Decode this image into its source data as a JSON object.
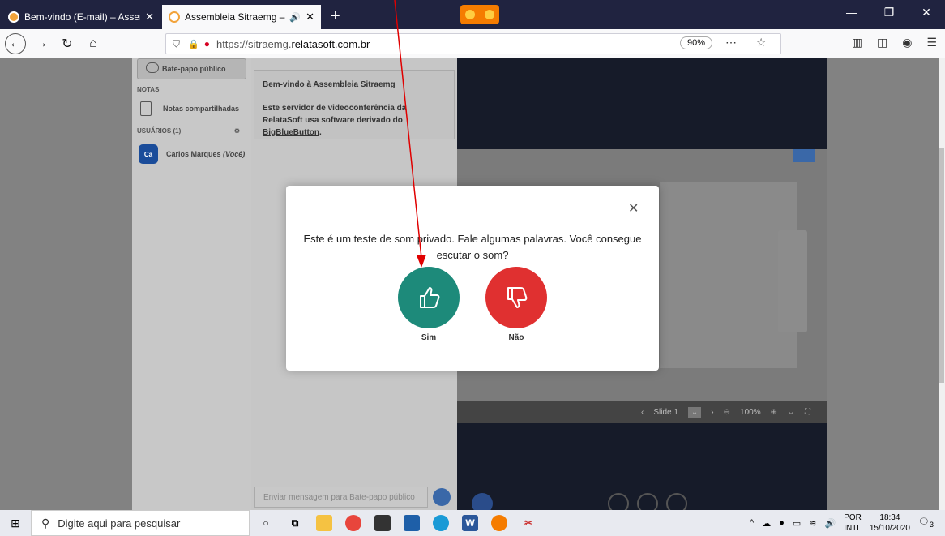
{
  "browser": {
    "tabs": [
      {
        "title": "Bem-vindo (E-mail) – Assembl"
      },
      {
        "title": "Assembleia Sitraemg – Pow"
      }
    ],
    "url_prefix": "https://sitraemg.",
    "url_domain": "relatasoft.com.br",
    "zoom": "90%"
  },
  "sidebar": {
    "chat_label": "Bate-papo público",
    "notes_section": "NOTAS",
    "shared_notes": "Notas compartilhadas",
    "users_section": "USUÁRIOS (1)",
    "user_initials": "Ca",
    "user_name": "Carlos Marques",
    "user_you": "(Você)"
  },
  "chat": {
    "welcome_title": "Bem-vindo à Assembleia Sitraemg",
    "welcome_body": "Este servidor de videoconferência da RelataSoft usa software derivado do",
    "welcome_link": "BigBlueButton",
    "input_placeholder": "Enviar mensagem para Bate-papo público"
  },
  "presentation": {
    "slide_label": "Slide 1",
    "zoom_label": "100%"
  },
  "modal": {
    "question": "Este é um teste de som privado. Fale algumas palavras. Você consegue escutar o som?",
    "yes_label": "Sim",
    "no_label": "Não"
  },
  "taskbar": {
    "search_placeholder": "Digite aqui para pesquisar",
    "lang_top": "POR",
    "lang_bottom": "INTL",
    "time": "18:34",
    "date": "15/10/2020",
    "notif_count": "3"
  },
  "colors": {
    "yes": "#1d8a7a",
    "no": "#e03030",
    "arrow": "#e00000"
  }
}
